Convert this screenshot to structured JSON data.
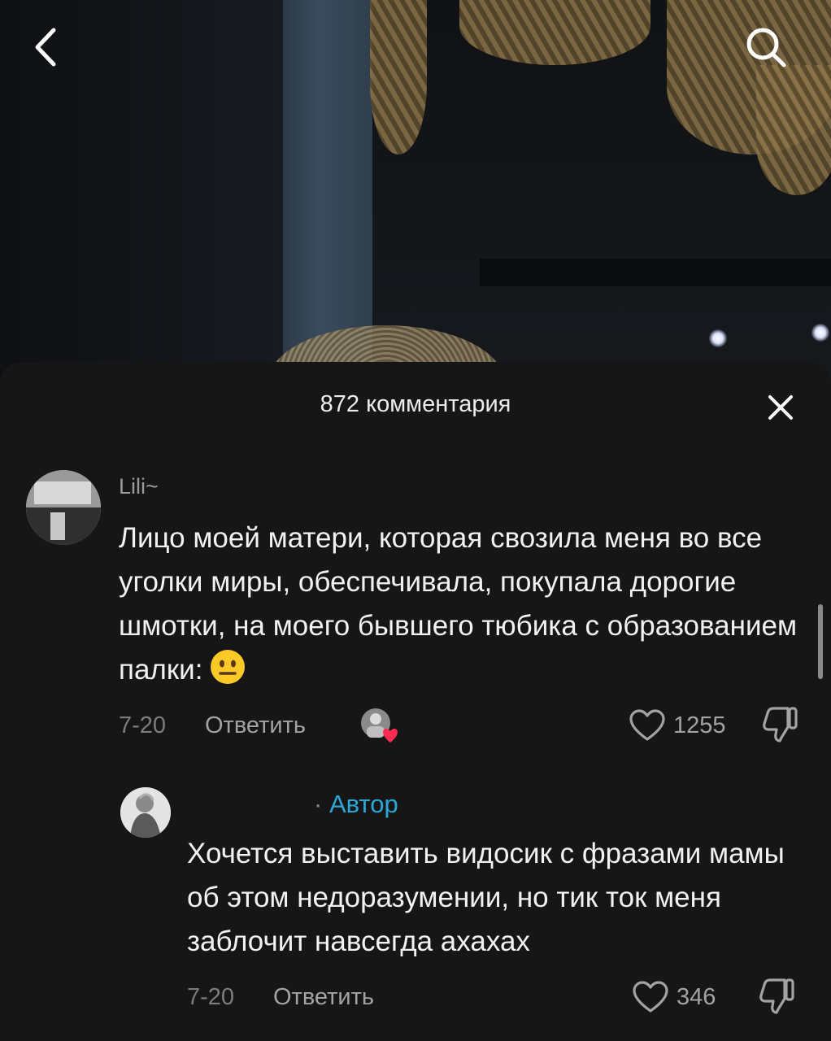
{
  "video": {
    "back_icon": "chevron-left-icon",
    "search_icon": "search-icon"
  },
  "comments_sheet": {
    "title": "872 комментария",
    "close_icon": "close-icon"
  },
  "comments": [
    {
      "username": "Lili~",
      "text": "Лицо моей матери, которая свозила меня во все уголки миры, обеспечивала, покупала дорогие шмотки, на моего бывшего тюбика с образованием палки:",
      "emoji": "neutral-face-emoji",
      "date": "7-20",
      "reply_label": "Ответить",
      "likes": "1255",
      "author_liked": true
    }
  ],
  "reply": {
    "author_label": "Автор",
    "text": "Хочется выставить видосик с фразами мамы об этом недоразумении, но тик ток меня заблочит навсегда ахахах",
    "date": "7-20",
    "reply_label": "Ответить",
    "likes": "346"
  },
  "colors": {
    "sheet_bg": "#161616",
    "author_accent": "#2aa8d8",
    "liked_heart": "#fe2c55"
  }
}
